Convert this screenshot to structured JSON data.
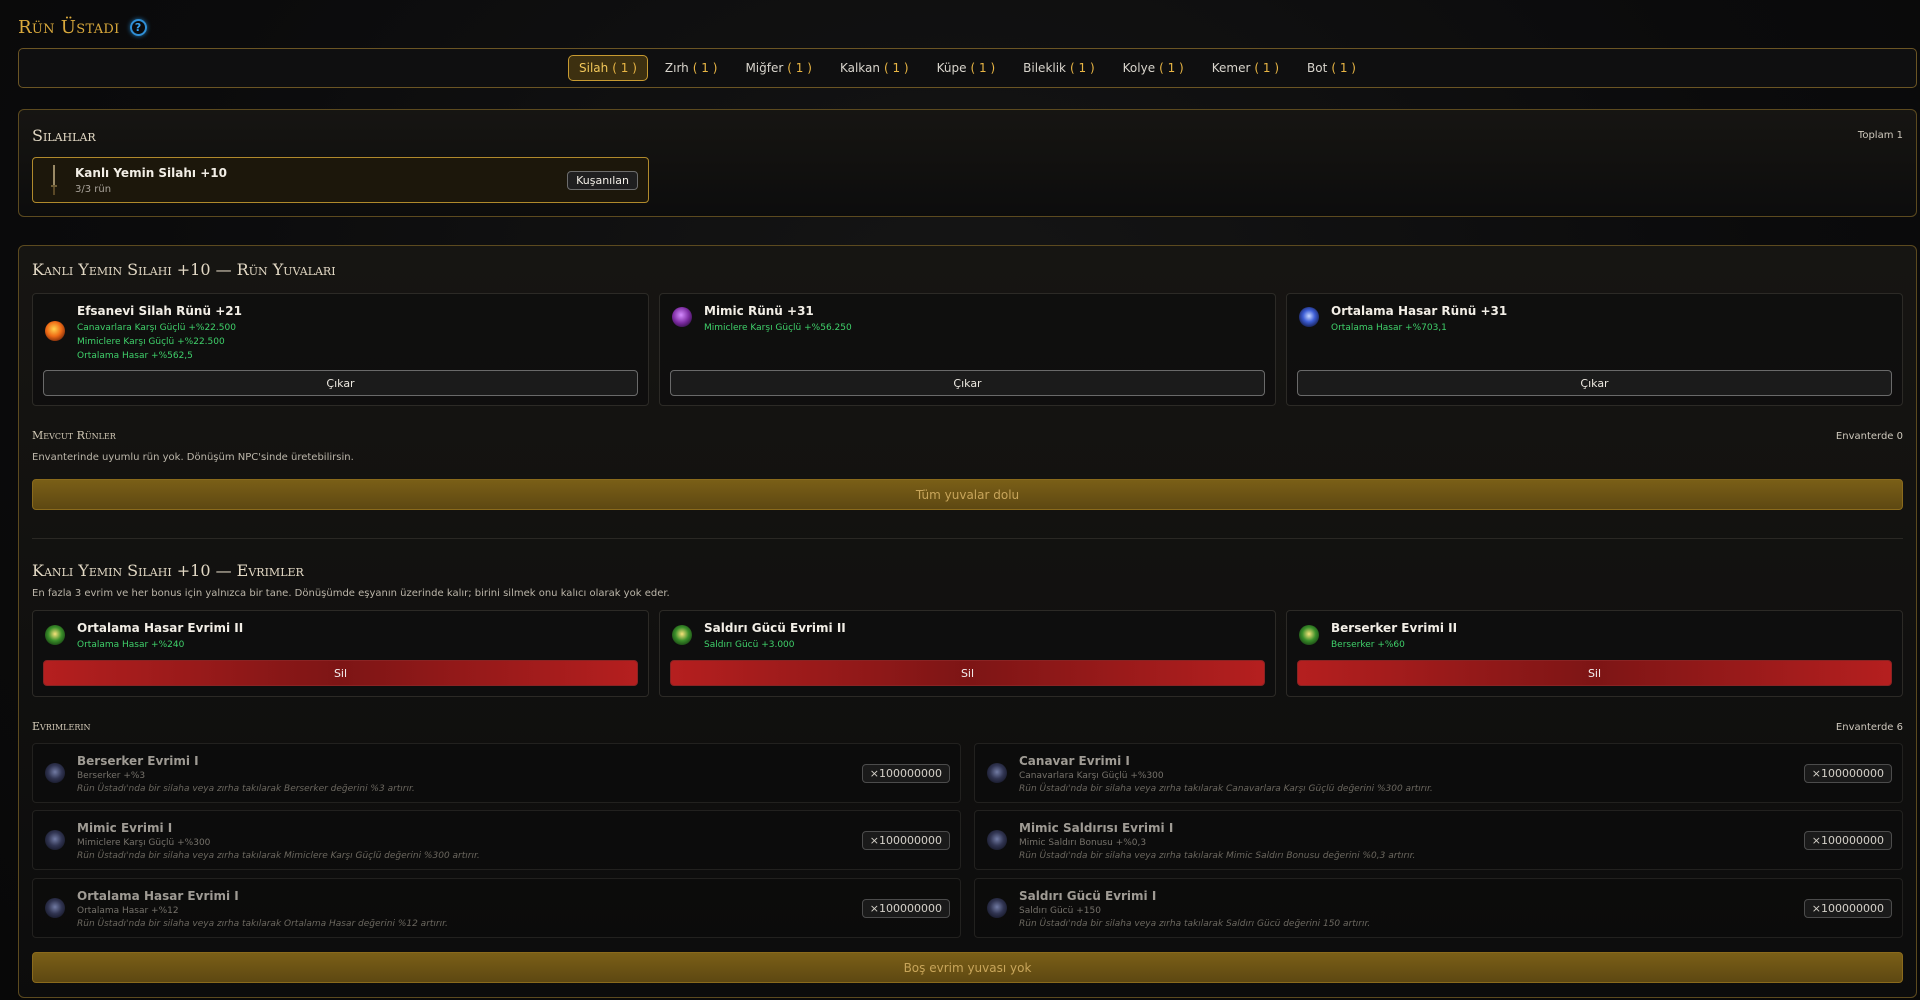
{
  "app": {
    "title": "Rün Üstadı",
    "help_icon": "question-icon"
  },
  "tabs": [
    {
      "label": "Silah",
      "count": "( 1 )",
      "active": true
    },
    {
      "label": "Zırh",
      "count": "( 1 )"
    },
    {
      "label": "Miğfer",
      "count": "( 1 )"
    },
    {
      "label": "Kalkan",
      "count": "( 1 )"
    },
    {
      "label": "Küpe",
      "count": "( 1 )"
    },
    {
      "label": "Bileklik",
      "count": "( 1 )"
    },
    {
      "label": "Kolye",
      "count": "( 1 )"
    },
    {
      "label": "Kemer",
      "count": "( 1 )"
    },
    {
      "label": "Bot",
      "count": "( 1 )"
    }
  ],
  "weapons": {
    "title": "Silahlar",
    "total": "Toplam 1",
    "item": {
      "name": "Kanlı Yemin Silahı +10",
      "sub": "3/3 rün",
      "badge": "Kuşanılan",
      "icon": "sword-icon"
    }
  },
  "rune_slots": {
    "title": "Kanlı Yemin Silahı +10 — Rün Yuvaları",
    "slots": [
      {
        "name": "Efsanevi Silah Rünü +21",
        "icon": "orange-rune-icon",
        "stats": [
          "Canavarlara Karşı Güçlü +%22.500",
          "Mimiclere Karşı Güçlü +%22.500",
          "Ortalama Hasar +%562,5"
        ],
        "button": "Çıkar"
      },
      {
        "name": "Mimic Rünü +31",
        "icon": "purple-rune-icon",
        "stats": [
          "Mimiclere Karşı Güçlü +%56.250"
        ],
        "button": "Çıkar"
      },
      {
        "name": "Ortalama Hasar Rünü +31",
        "icon": "blue-rune-icon",
        "stats": [
          "Ortalama Hasar +%703,1"
        ],
        "button": "Çıkar"
      }
    ],
    "available_title": "Mevcut Rünler",
    "available_note": "Envanterde 0",
    "available_empty": "Envanterinde uyumlu rün yok. Dönüşüm NPC'sinde üretebilirsin.",
    "full_bar": "Tüm yuvalar dolu"
  },
  "evolutions": {
    "title": "Kanlı Yemin Silahı +10 — Evrimler",
    "description": "En fazla 3 evrim ve her bonus için yalnızca bir tane. Dönüşümde eşyanın üzerinde kalır; birini silmek onu kalıcı olarak yok eder.",
    "slots": [
      {
        "name": "Ortalama Hasar Evrimi II",
        "stat": "Ortalama Hasar +%240",
        "button": "Sil",
        "icon": "evolution-emblem-icon"
      },
      {
        "name": "Saldırı Gücü Evrimi II",
        "stat": "Saldırı Gücü +3.000",
        "button": "Sil",
        "icon": "evolution-emblem-icon"
      },
      {
        "name": "Berserker Evrimi II",
        "stat": "Berserker +%60",
        "button": "Sil",
        "icon": "evolution-emblem-icon"
      }
    ],
    "inventory_title": "Evrimlerin",
    "inventory_note": "Envanterde 6",
    "inventory": [
      {
        "name": "Berserker Evrimi I",
        "stat": "Berserker +%3",
        "desc": "Rün Üstadı'nda bir silaha veya zırha takılarak Berserker değerini %3 artırır.",
        "qty": "×100000000"
      },
      {
        "name": "Canavar Evrimi I",
        "stat": "Canavarlara Karşı Güçlü +%300",
        "desc": "Rün Üstadı'nda bir silaha veya zırha takılarak Canavarlara Karşı Güçlü değerini %300 artırır.",
        "qty": "×100000000"
      },
      {
        "name": "Mimic Evrimi I",
        "stat": "Mimiclere Karşı Güçlü +%300",
        "desc": "Rün Üstadı'nda bir silaha veya zırha takılarak Mimiclere Karşı Güçlü değerini %300 artırır.",
        "qty": "×100000000"
      },
      {
        "name": "Mimic Saldırısı Evrimi I",
        "stat": "Mimic Saldırı Bonusu +%0,3",
        "desc": "Rün Üstadı'nda bir silaha veya zırha takılarak Mimic Saldırı Bonusu değerini %0,3 artırır.",
        "qty": "×100000000"
      },
      {
        "name": "Ortalama Hasar Evrimi I",
        "stat": "Ortalama Hasar +%12",
        "desc": "Rün Üstadı'nda bir silaha veya zırha takılarak Ortalama Hasar değerini %12 artırır.",
        "qty": "×100000000"
      },
      {
        "name": "Saldırı Gücü Evrimi I",
        "stat": "Saldırı Gücü +150",
        "desc": "Rün Üstadı'nda bir silaha veya zırha takılarak Saldırı Gücü değerini 150 artırır.",
        "qty": "×100000000"
      }
    ],
    "empty_bar": "Boş evrim yuvası yok"
  },
  "colors": {
    "gold": "#d9a93c",
    "green_stat": "#3fd06a",
    "danger": "#b51f1f"
  }
}
